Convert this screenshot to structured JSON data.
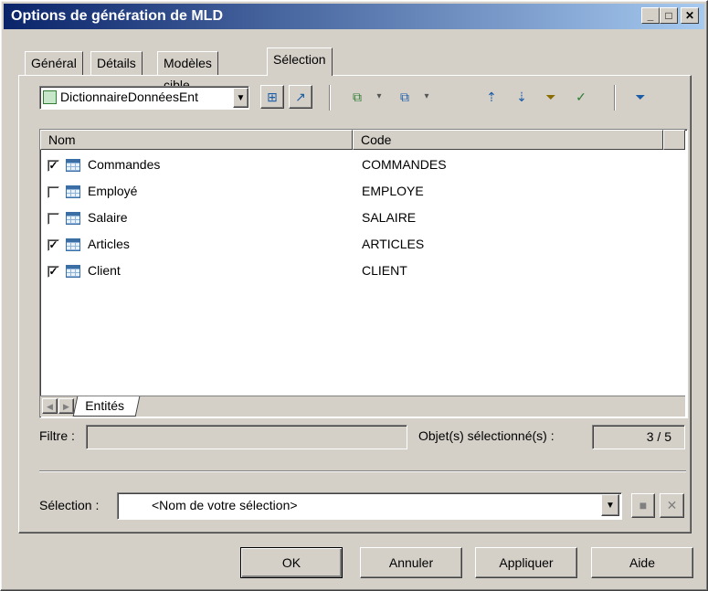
{
  "window": {
    "title": "Options de génération de MLD"
  },
  "title_buttons": {
    "minimize": "_",
    "maximize": "□",
    "close": "✕"
  },
  "tabs": [
    {
      "label": "Général"
    },
    {
      "label": "Détails"
    },
    {
      "label": "Modèles cible"
    },
    {
      "label": "Sélection"
    }
  ],
  "toolbar": {
    "model_selector_value": "DictionnaireDonnéesEnt"
  },
  "table": {
    "columns": [
      "Nom",
      "Code"
    ],
    "rows": [
      {
        "name": "Commandes",
        "code": "COMMANDES",
        "checked": true
      },
      {
        "name": "Employé",
        "code": "EMPLOYE",
        "checked": false
      },
      {
        "name": "Salaire",
        "code": "SALAIRE",
        "checked": false
      },
      {
        "name": "Articles",
        "code": "ARTICLES",
        "checked": true
      },
      {
        "name": "Client",
        "code": "CLIENT",
        "checked": true
      }
    ]
  },
  "subtabs": {
    "active": "Entités"
  },
  "filter": {
    "label": "Filtre :",
    "value": ""
  },
  "selected_count": {
    "label": "Objet(s) sélectionné(s) :",
    "value": "3 / 5"
  },
  "selection": {
    "label": "Sélection :",
    "value": "<Nom de votre sélection>"
  },
  "buttons": {
    "ok": "OK",
    "cancel": "Annuler",
    "apply": "Appliquer",
    "help": "Aide"
  },
  "colors": {
    "title_gradient_start": "#0a246a",
    "title_gradient_end": "#a6caf0",
    "face": "#d4d0c8"
  }
}
